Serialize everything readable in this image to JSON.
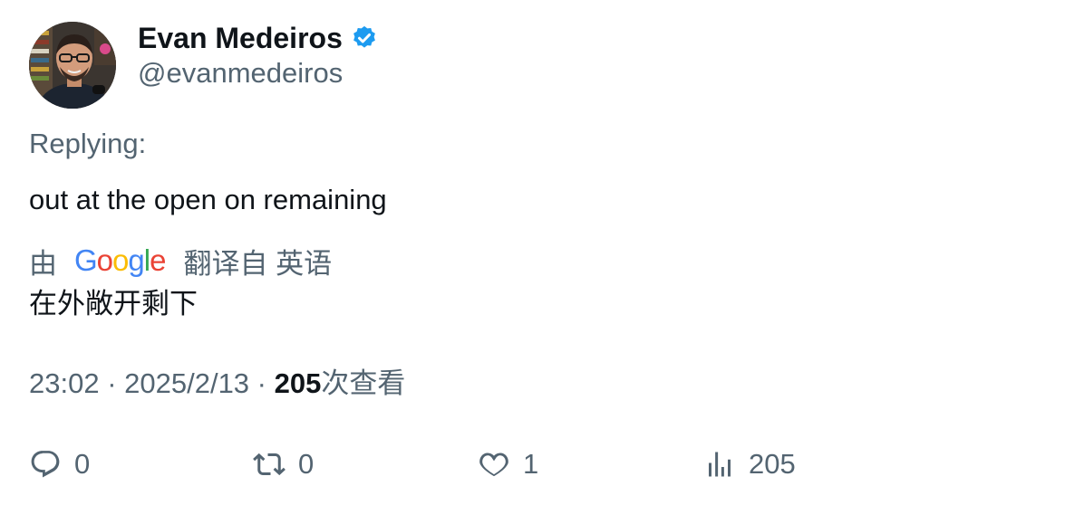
{
  "author": {
    "name": "Evan Medeiros",
    "handle": "@evanmedeiros",
    "verified_color": "#1d9bf0"
  },
  "tweet": {
    "replying_label": "Replying:",
    "text": "out at the open on remaining"
  },
  "translation": {
    "prefix": "由",
    "provider_letters": [
      "G",
      "o",
      "o",
      "g",
      "l",
      "e"
    ],
    "provider_colors": [
      "#4285f4",
      "#ea4335",
      "#fbbc05",
      "#4285f4",
      "#34a853",
      "#ea4335"
    ],
    "suffix": "翻译自 英语",
    "translated_text": "在外敞开剩下"
  },
  "meta": {
    "time": "23:02",
    "separator": " · ",
    "date": "2025/2/13",
    "views_count": "205",
    "views_label": "次查看"
  },
  "actions": {
    "reply": {
      "icon": "reply-bubble-icon",
      "count": "0"
    },
    "retweet": {
      "icon": "retweet-icon",
      "count": "0"
    },
    "like": {
      "icon": "heart-icon",
      "count": "1"
    },
    "views": {
      "icon": "bar-chart-icon",
      "count": "205"
    }
  }
}
